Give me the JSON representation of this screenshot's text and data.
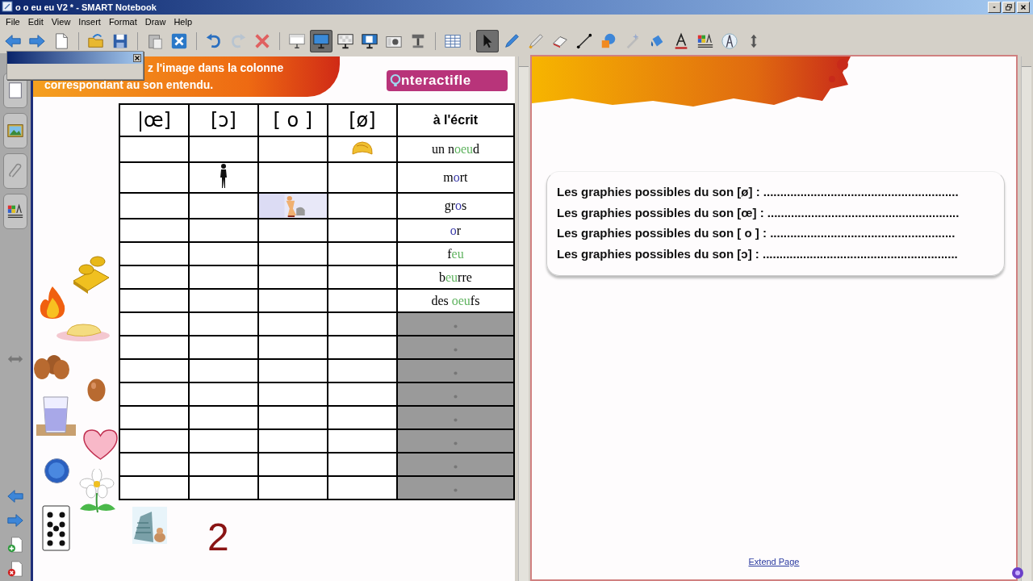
{
  "window": {
    "title": "o o eu eu V2 * - SMART Notebook"
  },
  "menu": [
    "File",
    "Edit",
    "View",
    "Insert",
    "Format",
    "Draw",
    "Help"
  ],
  "toolbar": [
    {
      "kind": "back",
      "selected": false
    },
    {
      "kind": "forward",
      "selected": false
    },
    {
      "kind": "page",
      "selected": false
    },
    {
      "kind": "sep",
      "selected": false
    },
    {
      "kind": "open",
      "selected": false
    },
    {
      "kind": "save",
      "selected": false
    },
    {
      "kind": "sep",
      "selected": false
    },
    {
      "kind": "paste",
      "selected": false
    },
    {
      "kind": "close_doc",
      "selected": false
    },
    {
      "kind": "sep",
      "selected": false
    },
    {
      "kind": "undo",
      "selected": false
    },
    {
      "kind": "redo",
      "selected": false
    },
    {
      "kind": "delete",
      "selected": false
    },
    {
      "kind": "sep",
      "selected": false
    },
    {
      "kind": "shade",
      "selected": false
    },
    {
      "kind": "display",
      "selected": true
    },
    {
      "kind": "transparent",
      "selected": false
    },
    {
      "kind": "dual",
      "selected": false
    },
    {
      "kind": "camera",
      "selected": false
    },
    {
      "kind": "doccam",
      "selected": false
    },
    {
      "kind": "sep",
      "selected": false
    },
    {
      "kind": "table",
      "selected": false
    },
    {
      "kind": "sep",
      "selected": false
    },
    {
      "kind": "select",
      "selected": true
    },
    {
      "kind": "pen",
      "selected": false
    },
    {
      "kind": "creative_pen",
      "selected": false
    },
    {
      "kind": "eraser",
      "selected": false
    },
    {
      "kind": "line",
      "selected": false
    },
    {
      "kind": "shapes",
      "selected": false
    },
    {
      "kind": "magic_pen",
      "selected": false
    },
    {
      "kind": "fill",
      "selected": false
    },
    {
      "kind": "text",
      "selected": false
    },
    {
      "kind": "properties",
      "selected": false
    },
    {
      "kind": "compass",
      "selected": false
    },
    {
      "kind": "updown",
      "selected": false
    }
  ],
  "sidebar": [
    {
      "kind": "pages"
    },
    {
      "kind": "gallery"
    },
    {
      "kind": "attachments"
    },
    {
      "kind": "properties"
    },
    {
      "kind": "resize"
    },
    {
      "kind": "previous"
    },
    {
      "kind": "next"
    },
    {
      "kind": "add_page"
    },
    {
      "kind": "delete_page"
    }
  ],
  "left_page": {
    "instructions": [
      "z l'image dans la colonne",
      "correspondant au son entendu."
    ],
    "logo": "nteractifle",
    "table": {
      "columns": [
        "|œ]",
        "[ɔ]",
        "[ o ]",
        "[ø]",
        "à l'écrit"
      ],
      "rows": [
        {
          "cells": [
            {
              "kind": "empty"
            },
            {
              "kind": "empty"
            },
            {
              "kind": "empty"
            },
            {
              "kind": "hair"
            }
          ],
          "shaded": false,
          "word": [
            {
              "text": "un n"
            },
            {
              "text": "oeu",
              "color": "#5fb35f"
            },
            {
              "text": "d"
            }
          ]
        },
        {
          "cells": [
            {
              "kind": "empty"
            },
            {
              "kind": "figure"
            },
            {
              "kind": "empty"
            },
            {
              "kind": "empty"
            }
          ],
          "shaded": false,
          "word": [
            {
              "text": "m"
            },
            {
              "text": "o",
              "color": "#3a3aa8"
            },
            {
              "text": "rt"
            }
          ]
        },
        {
          "cells": [
            {
              "kind": "empty"
            },
            {
              "kind": "empty"
            },
            {
              "kind": "picture"
            },
            {
              "kind": "empty"
            }
          ],
          "shaded": false,
          "word": [
            {
              "text": "gr"
            },
            {
              "text": "o",
              "color": "#3a3aa8"
            },
            {
              "text": "s"
            }
          ]
        },
        {
          "cells": [
            {
              "kind": "empty"
            },
            {
              "kind": "empty"
            },
            {
              "kind": "empty"
            },
            {
              "kind": "empty"
            }
          ],
          "shaded": false,
          "word": [
            {
              "text": "o",
              "color": "#3a3aa8"
            },
            {
              "text": "r"
            }
          ]
        },
        {
          "cells": [
            {
              "kind": "empty"
            },
            {
              "kind": "empty"
            },
            {
              "kind": "empty"
            },
            {
              "kind": "empty"
            }
          ],
          "shaded": false,
          "word": [
            {
              "text": "f"
            },
            {
              "text": "eu",
              "color": "#5fb35f"
            }
          ]
        },
        {
          "cells": [
            {
              "kind": "empty"
            },
            {
              "kind": "empty"
            },
            {
              "kind": "empty"
            },
            {
              "kind": "empty"
            }
          ],
          "shaded": false,
          "word": [
            {
              "text": "b"
            },
            {
              "text": "eu",
              "color": "#5fb35f"
            },
            {
              "text": "rre"
            }
          ]
        },
        {
          "cells": [
            {
              "kind": "empty"
            },
            {
              "kind": "empty"
            },
            {
              "kind": "empty"
            },
            {
              "kind": "empty"
            }
          ],
          "shaded": false,
          "word": [
            {
              "text": "des "
            },
            {
              "text": "oeu",
              "color": "#5fb35f"
            },
            {
              "text": "fs"
            }
          ]
        },
        {
          "cells": [
            {
              "kind": "empty"
            },
            {
              "kind": "empty"
            },
            {
              "kind": "empty"
            },
            {
              "kind": "empty"
            }
          ],
          "shaded": true
        },
        {
          "cells": [
            {
              "kind": "empty"
            },
            {
              "kind": "empty"
            },
            {
              "kind": "empty"
            },
            {
              "kind": "empty"
            }
          ],
          "shaded": true
        },
        {
          "cells": [
            {
              "kind": "empty"
            },
            {
              "kind": "empty"
            },
            {
              "kind": "empty"
            },
            {
              "kind": "empty"
            }
          ],
          "shaded": true
        },
        {
          "cells": [
            {
              "kind": "empty"
            },
            {
              "kind": "empty"
            },
            {
              "kind": "empty"
            },
            {
              "kind": "empty"
            }
          ],
          "shaded": true
        },
        {
          "cells": [
            {
              "kind": "empty"
            },
            {
              "kind": "empty"
            },
            {
              "kind": "empty"
            },
            {
              "kind": "empty"
            }
          ],
          "shaded": true
        },
        {
          "cells": [
            {
              "kind": "empty"
            },
            {
              "kind": "empty"
            },
            {
              "kind": "empty"
            },
            {
              "kind": "empty"
            }
          ],
          "shaded": true
        },
        {
          "cells": [
            {
              "kind": "empty"
            },
            {
              "kind": "empty"
            },
            {
              "kind": "empty"
            },
            {
              "kind": "empty"
            }
          ],
          "shaded": true
        },
        {
          "cells": [
            {
              "kind": "empty"
            },
            {
              "kind": "empty"
            },
            {
              "kind": "empty"
            },
            {
              "kind": "empty"
            }
          ],
          "shaded": true
        }
      ]
    },
    "clipart": [
      {
        "kind": "gold"
      },
      {
        "kind": "fire"
      },
      {
        "kind": "butter"
      },
      {
        "kind": "eggs"
      },
      {
        "kind": "egg"
      },
      {
        "kind": "glass"
      },
      {
        "kind": "heart"
      },
      {
        "kind": "ball"
      },
      {
        "kind": "flower"
      },
      {
        "kind": "card"
      },
      {
        "kind": "picture"
      }
    ],
    "page_number": "2"
  },
  "right_page": {
    "lines": [
      "Les graphies possibles du son [ø] : ..........................................................",
      "Les graphies possibles du son [œ] : .........................................................",
      "Les graphies possibles du son [ o ] : .......................................................",
      "Les graphies possibles du son [ɔ] : .........................................................."
    ],
    "extend_link": "Extend Page"
  }
}
